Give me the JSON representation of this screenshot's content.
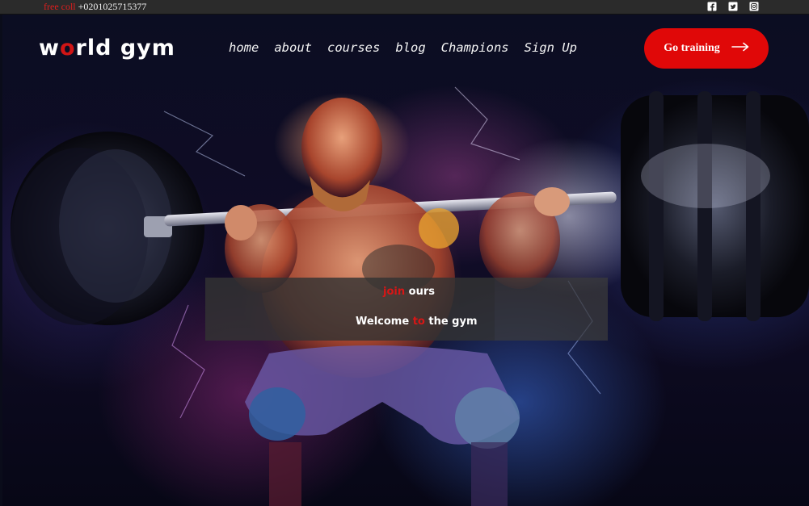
{
  "topbar": {
    "free_label": "free coll",
    "phone": "+0201025715377",
    "socials": [
      {
        "icon": "facebook-icon"
      },
      {
        "icon": "twitter-icon"
      },
      {
        "icon": "instagram-icon"
      }
    ]
  },
  "header": {
    "logo_prefix": "w",
    "logo_highlight": "o",
    "logo_suffix": "rld gym",
    "nav": [
      "home",
      "about",
      "courses",
      "blog",
      "Champions",
      "Sign Up"
    ],
    "cta_label": "Go training",
    "cta_icon": "arrow-right-icon"
  },
  "hero": {
    "join_highlight": "join",
    "join_rest": " ours",
    "welcome_prefix": "Welcome ",
    "welcome_highlight": "to",
    "welcome_suffix": " the gym"
  },
  "colors": {
    "accent": "#e00808",
    "topbar_bg": "#2b2b2b",
    "text": "#ffffff"
  }
}
